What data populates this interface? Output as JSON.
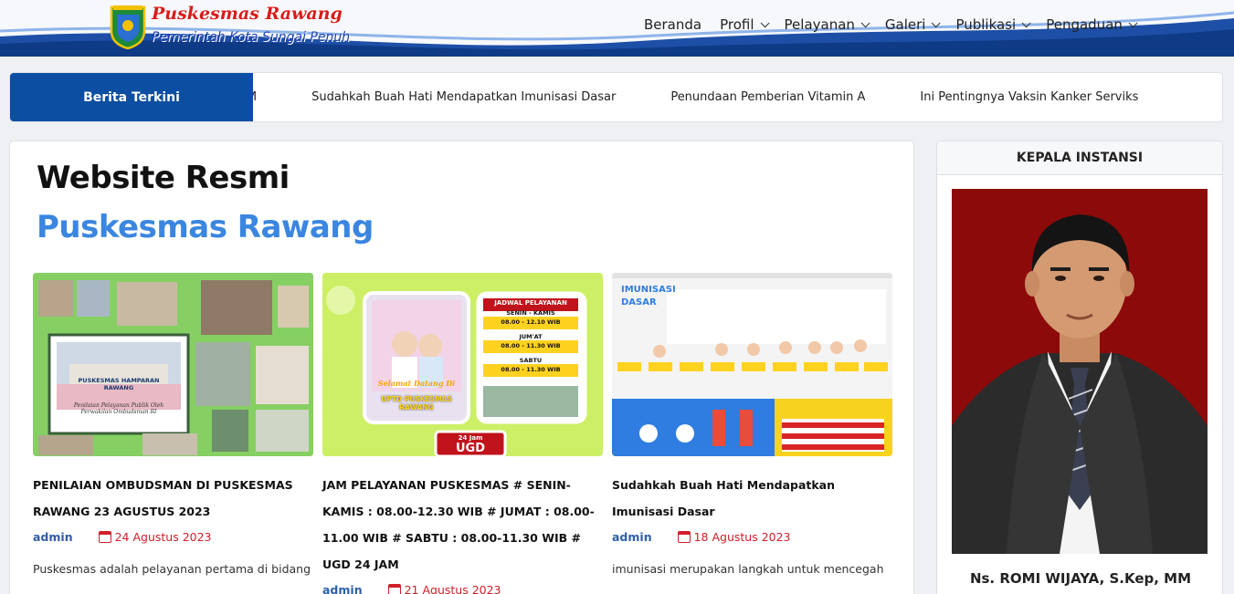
{
  "header": {
    "brand_title": "Puskesmas Rawang",
    "brand_subtitle": "Pemerintah Kota Sungai Penuh",
    "nav": [
      {
        "label": "Beranda",
        "dropdown": false
      },
      {
        "label": "Profil",
        "dropdown": true
      },
      {
        "label": "Pelayanan",
        "dropdown": true
      },
      {
        "label": "Galeri",
        "dropdown": true
      },
      {
        "label": "Publikasi",
        "dropdown": true
      },
      {
        "label": "Pengaduan",
        "dropdown": true
      }
    ]
  },
  "ticker": {
    "label": "Berita Terkini",
    "items": [
      "AM",
      "Sudahkah Buah Hati Mendapatkan Imunisasi Dasar",
      "Penundaan Pemberian Vitamin A",
      "Ini Pentingnya Vaksin Kanker Serviks"
    ]
  },
  "main": {
    "title_line1": "Website Resmi",
    "title_line2": "Puskesmas Rawang",
    "posts": [
      {
        "title": "PENILAIAN OMBUDSMAN DI PUSKESMAS RAWANG 23 AGUSTUS 2023",
        "author": "admin",
        "date": "24 Agustus 2023",
        "excerpt": "Puskesmas adalah pelayanan pertama di bidang",
        "thumb_caption": "PUSKESMAS HAMPARAN RAWANG",
        "thumb_note": "Penilaian Pelayanan Publik Oleh Perwakilan Ombudsman RI"
      },
      {
        "title": "JAM PELAYANAN PUSKESMAS # SENIN-KAMIS : 08.00-12.30 WIB # JUMAT : 08.00-11.00 WIB # SABTU : 08.00-11.30 WIB # UGD 24 JAM",
        "author": "admin",
        "date": "21 Agustus 2023",
        "excerpt": "",
        "thumb_welcome": "Selamat Datang Di",
        "thumb_unit": "UPTD PUSKESMAS RAWANG",
        "thumb_schedule_title": "JADWAL PELAYANAN",
        "thumb_days": [
          "SENIN - KAMIS",
          "JUM'AT",
          "SABTU"
        ],
        "thumb_hours": [
          "08.00 - 12.10 WIB",
          "08.00 - 11.30 WIB",
          "08.00 - 11.30 WIB"
        ],
        "thumb_badge_top": "24 Jam",
        "thumb_badge": "UGD"
      },
      {
        "title": "Sudahkah Buah Hati Mendapatkan Imunisasi Dasar",
        "author": "admin",
        "date": "18 Agustus 2023",
        "excerpt": "imunisasi merupakan langkah untuk mencegah",
        "thumb_heading": "IMUNISASI DASAR"
      }
    ]
  },
  "sidebar": {
    "heading": "KEPALA INSTANSI",
    "name": "Ns. ROMI WIJAYA, S.Kep, MM"
  },
  "colors": {
    "primary": "#0b4ea2",
    "accent_title": "#3a86e0",
    "date_red": "#d0202a",
    "author_blue": "#2f5fa8",
    "photo_bg": "#8c0a0a"
  }
}
